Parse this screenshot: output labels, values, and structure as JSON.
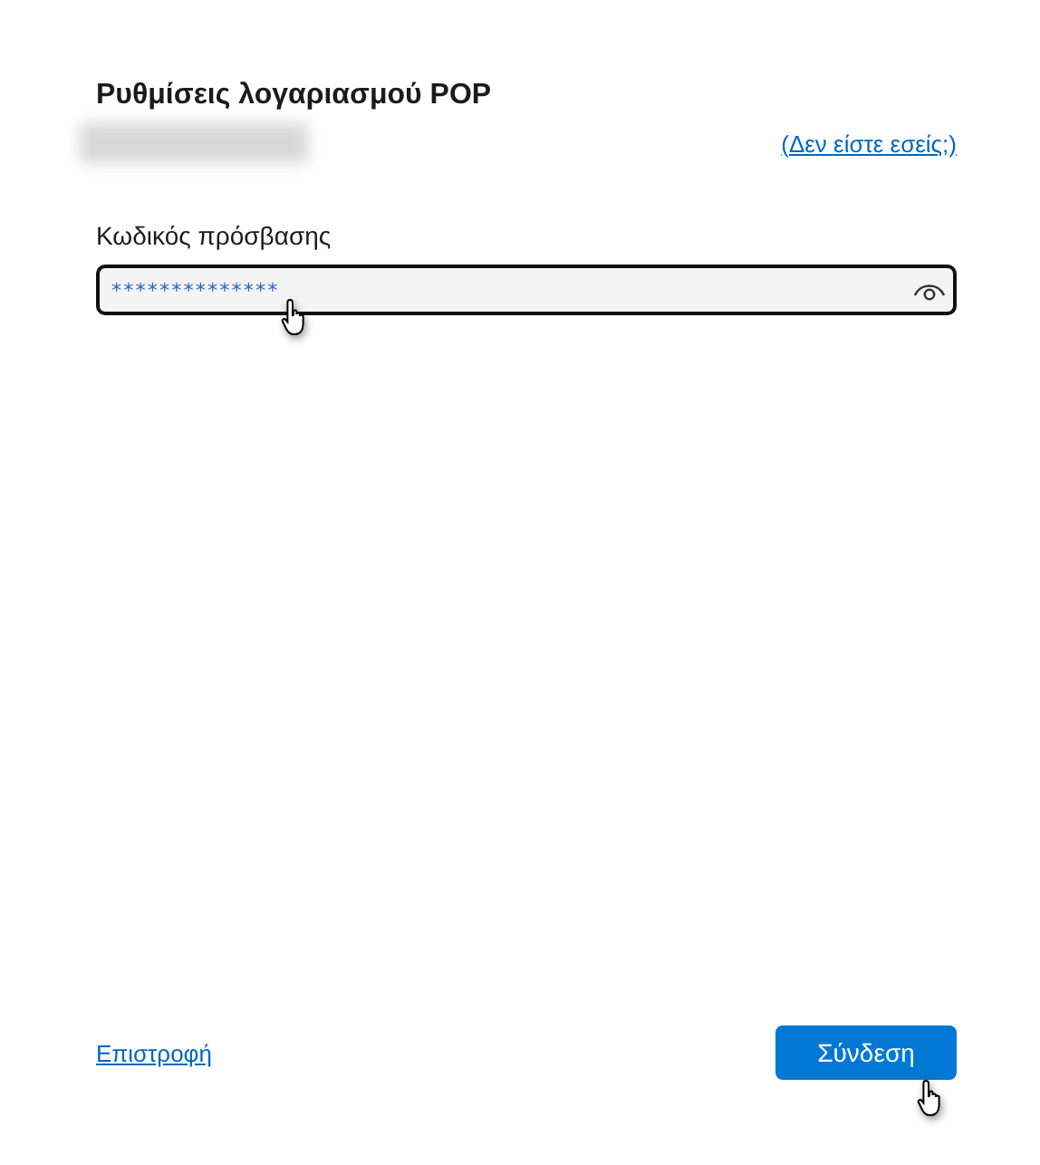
{
  "title": "Ρυθμίσεις λογαριασμού POP",
  "account_link": "(Δεν είστε εσείς;)",
  "password": {
    "label": "Κωδικός πρόσβασης",
    "value": "**************"
  },
  "back_link": "Επιστροφή",
  "connect_button": "Σύνδεση"
}
